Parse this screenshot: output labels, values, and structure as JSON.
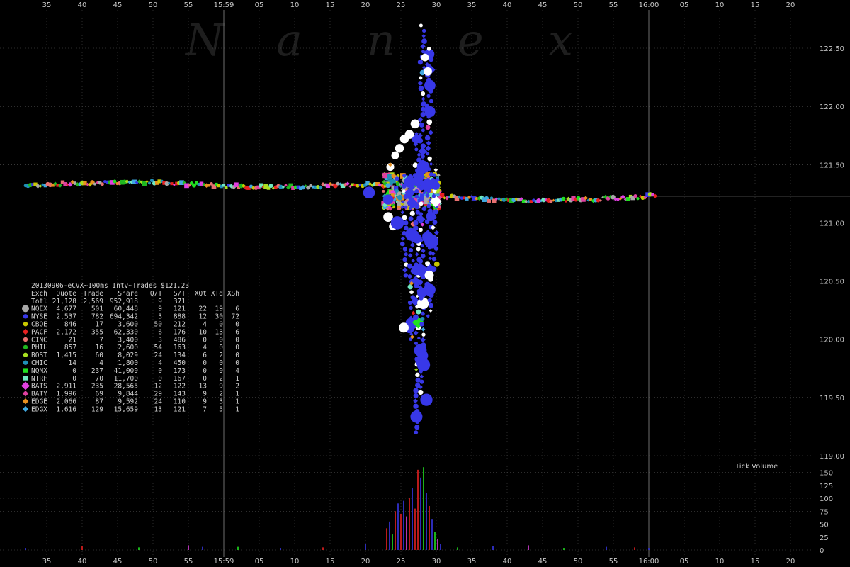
{
  "watermark": [
    "N",
    "a",
    "n",
    "e",
    "x"
  ],
  "chart_data": {
    "type": "scatter",
    "title": "20130906-eCVX~100ms Intv~Trades $121.23",
    "price_axis": {
      "min": 118.85,
      "max": 122.85,
      "ticks": [
        "119.00",
        "119.50",
        "120.00",
        "120.50",
        "121.00",
        "121.50",
        "122.00",
        "122.50"
      ]
    },
    "time_axis": {
      "ticks": [
        {
          "t": -25,
          "label": "35"
        },
        {
          "t": -20,
          "label": "40"
        },
        {
          "t": -15,
          "label": "45"
        },
        {
          "t": -10,
          "label": "50"
        },
        {
          "t": -5,
          "label": "55"
        },
        {
          "t": 0,
          "label": "15:59"
        },
        {
          "t": 5,
          "label": "05"
        },
        {
          "t": 10,
          "label": "10"
        },
        {
          "t": 15,
          "label": "15"
        },
        {
          "t": 20,
          "label": "20"
        },
        {
          "t": 25,
          "label": "25"
        },
        {
          "t": 30,
          "label": "30"
        },
        {
          "t": 35,
          "label": "35"
        },
        {
          "t": 40,
          "label": "40"
        },
        {
          "t": 45,
          "label": "45"
        },
        {
          "t": 50,
          "label": "50"
        },
        {
          "t": 55,
          "label": "55"
        },
        {
          "t": 60,
          "label": "16:00"
        },
        {
          "t": 65,
          "label": "05"
        },
        {
          "t": 70,
          "label": "10"
        },
        {
          "t": 75,
          "label": "15"
        },
        {
          "t": 80,
          "label": "20"
        }
      ],
      "minute_markers": [
        0,
        60
      ]
    },
    "volume_panel": {
      "label": "Tick Volume",
      "max": 165,
      "ticks": [
        "0",
        "25",
        "50",
        "75",
        "100",
        "125",
        "150"
      ]
    },
    "last_trade_price": 121.23,
    "legend": {
      "headers": [
        "Exch",
        "Quote",
        "Trade",
        "Share",
        "Q/T",
        "S/T",
        "XQt",
        "XTd",
        "XSh"
      ],
      "total": {
        "label": "Totl",
        "values": [
          "21,128",
          "2,569",
          "952,918",
          "9",
          "371",
          "",
          "",
          ""
        ]
      },
      "rows": [
        {
          "exch": "NQEX",
          "color": "#a8a8a8",
          "shape": "circle-lg",
          "values": [
            "4,677",
            "501",
            "60,448",
            "9",
            "121",
            "22",
            "19",
            "6"
          ]
        },
        {
          "exch": "NYSE",
          "color": "#3838e8",
          "shape": "circle",
          "values": [
            "2,537",
            "782",
            "694,342",
            "3",
            "888",
            "12",
            "30",
            "72"
          ]
        },
        {
          "exch": "CBOE",
          "color": "#c8c800",
          "shape": "circle",
          "values": [
            "846",
            "17",
            "3,600",
            "50",
            "212",
            "4",
            "0",
            "0"
          ]
        },
        {
          "exch": "PACF",
          "color": "#e82020",
          "shape": "diamond",
          "values": [
            "2,172",
            "355",
            "62,330",
            "6",
            "176",
            "10",
            "13",
            "6"
          ]
        },
        {
          "exch": "CINC",
          "color": "#e87070",
          "shape": "circle",
          "values": [
            "21",
            "7",
            "3,400",
            "3",
            "486",
            "0",
            "0",
            "0"
          ]
        },
        {
          "exch": "PHIL",
          "color": "#20b820",
          "shape": "circle",
          "values": [
            "857",
            "16",
            "2,600",
            "54",
            "163",
            "4",
            "0",
            "0"
          ]
        },
        {
          "exch": "BOST",
          "color": "#a8e020",
          "shape": "circle",
          "values": [
            "1,415",
            "60",
            "8,029",
            "24",
            "134",
            "6",
            "2",
            "0"
          ]
        },
        {
          "exch": "CHIC",
          "color": "#2090b8",
          "shape": "circle",
          "values": [
            "14",
            "4",
            "1,800",
            "4",
            "450",
            "0",
            "0",
            "0"
          ]
        },
        {
          "exch": "NQNX",
          "color": "#20e020",
          "shape": "square",
          "values": [
            "0",
            "237",
            "41,009",
            "0",
            "173",
            "0",
            "9",
            "4"
          ]
        },
        {
          "exch": "NTRF",
          "color": "#70e8c0",
          "shape": "square",
          "values": [
            "0",
            "70",
            "11,700",
            "0",
            "167",
            "0",
            "2",
            "1"
          ]
        },
        {
          "exch": "BATS",
          "color": "#e040e0",
          "shape": "diamond-lg",
          "values": [
            "2,911",
            "235",
            "28,565",
            "12",
            "122",
            "13",
            "9",
            "2"
          ]
        },
        {
          "exch": "BATY",
          "color": "#e040a0",
          "shape": "diamond",
          "values": [
            "1,996",
            "69",
            "9,844",
            "29",
            "143",
            "9",
            "2",
            "1"
          ]
        },
        {
          "exch": "EDGE",
          "color": "#e89020",
          "shape": "diamond",
          "values": [
            "2,066",
            "87",
            "9,592",
            "24",
            "110",
            "9",
            "3",
            "1"
          ]
        },
        {
          "exch": "EDGX",
          "color": "#40a8e0",
          "shape": "diamond",
          "values": [
            "1,616",
            "129",
            "15,659",
            "13",
            "121",
            "7",
            "5",
            "1"
          ]
        }
      ]
    },
    "price_path": [
      [
        -28,
        121.32
      ],
      [
        -25,
        121.33
      ],
      [
        -20,
        121.34
      ],
      [
        -15,
        121.35
      ],
      [
        -10,
        121.35
      ],
      [
        -5,
        121.33
      ],
      [
        0,
        121.32
      ],
      [
        5,
        121.31
      ],
      [
        10,
        121.31
      ],
      [
        15,
        121.32
      ],
      [
        19,
        121.33
      ],
      [
        21,
        121.33
      ],
      [
        22.5,
        121.32
      ],
      [
        23,
        121.4
      ],
      [
        23.5,
        121.55
      ],
      [
        24.5,
        121.7
      ],
      [
        25.5,
        121.85
      ],
      [
        26.5,
        122.0
      ],
      [
        27.5,
        122.3
      ],
      [
        28,
        122.8
      ],
      [
        28.3,
        121.3
      ],
      [
        28.6,
        121.2
      ],
      [
        28.9,
        121.3
      ],
      [
        30,
        121.23
      ],
      [
        33,
        121.22
      ],
      [
        36,
        121.21
      ],
      [
        40,
        121.19
      ],
      [
        45,
        121.19
      ],
      [
        50,
        121.2
      ],
      [
        55,
        121.21
      ],
      [
        59,
        121.22
      ],
      [
        60,
        121.23
      ],
      [
        62,
        121.23
      ]
    ],
    "last_line": {
      "from": 60,
      "to": 95,
      "price": 121.23
    },
    "drop_columns": [
      {
        "t": 25.5,
        "low": 120.55,
        "high": 121.45
      },
      {
        "t": 26.5,
        "low": 120.0,
        "high": 121.4
      },
      {
        "t": 27.3,
        "low": 119.2,
        "high": 121.8
      },
      {
        "t": 28.0,
        "low": 119.5,
        "high": 122.7
      },
      {
        "t": 29.0,
        "low": 120.2,
        "high": 122.5
      },
      {
        "t": 29.8,
        "low": 120.6,
        "high": 121.5
      }
    ],
    "volume_bars": [
      [
        23,
        42,
        "#e82020"
      ],
      [
        23.4,
        55,
        "#3838e8"
      ],
      [
        23.8,
        30,
        "#20e020"
      ],
      [
        24.2,
        75,
        "#e82020"
      ],
      [
        24.6,
        90,
        "#3838e8"
      ],
      [
        25,
        70,
        "#e82020"
      ],
      [
        25.4,
        95,
        "#3838e8"
      ],
      [
        25.8,
        65,
        "#e040e0"
      ],
      [
        26.2,
        100,
        "#e82020"
      ],
      [
        26.6,
        120,
        "#3838e8"
      ],
      [
        27,
        80,
        "#e82020"
      ],
      [
        27.4,
        155,
        "#e82020"
      ],
      [
        27.8,
        140,
        "#3838e8"
      ],
      [
        28.2,
        160,
        "#20e020"
      ],
      [
        28.6,
        110,
        "#3838e8"
      ],
      [
        29,
        85,
        "#e82020"
      ],
      [
        29.4,
        60,
        "#3838e8"
      ],
      [
        29.8,
        35,
        "#20e020"
      ],
      [
        30.2,
        22,
        "#e040e0"
      ],
      [
        30.6,
        12,
        "#3838e8"
      ],
      [
        -28,
        4,
        "#3838e8"
      ],
      [
        -20,
        8,
        "#e82020"
      ],
      [
        -12,
        5,
        "#20e020"
      ],
      [
        -5,
        9,
        "#e040e0"
      ],
      [
        -3,
        6,
        "#3838e8"
      ],
      [
        2,
        6,
        "#20e020"
      ],
      [
        8,
        4,
        "#3838e8"
      ],
      [
        14,
        5,
        "#e82020"
      ],
      [
        20,
        11,
        "#3838e8"
      ],
      [
        33,
        5,
        "#20e020"
      ],
      [
        38,
        7,
        "#3838e8"
      ],
      [
        43,
        9,
        "#e040e0"
      ],
      [
        48,
        4,
        "#20e020"
      ],
      [
        54,
        6,
        "#3838e8"
      ],
      [
        58,
        5,
        "#e82020"
      ],
      [
        60,
        4,
        "#3838e8"
      ]
    ]
  }
}
